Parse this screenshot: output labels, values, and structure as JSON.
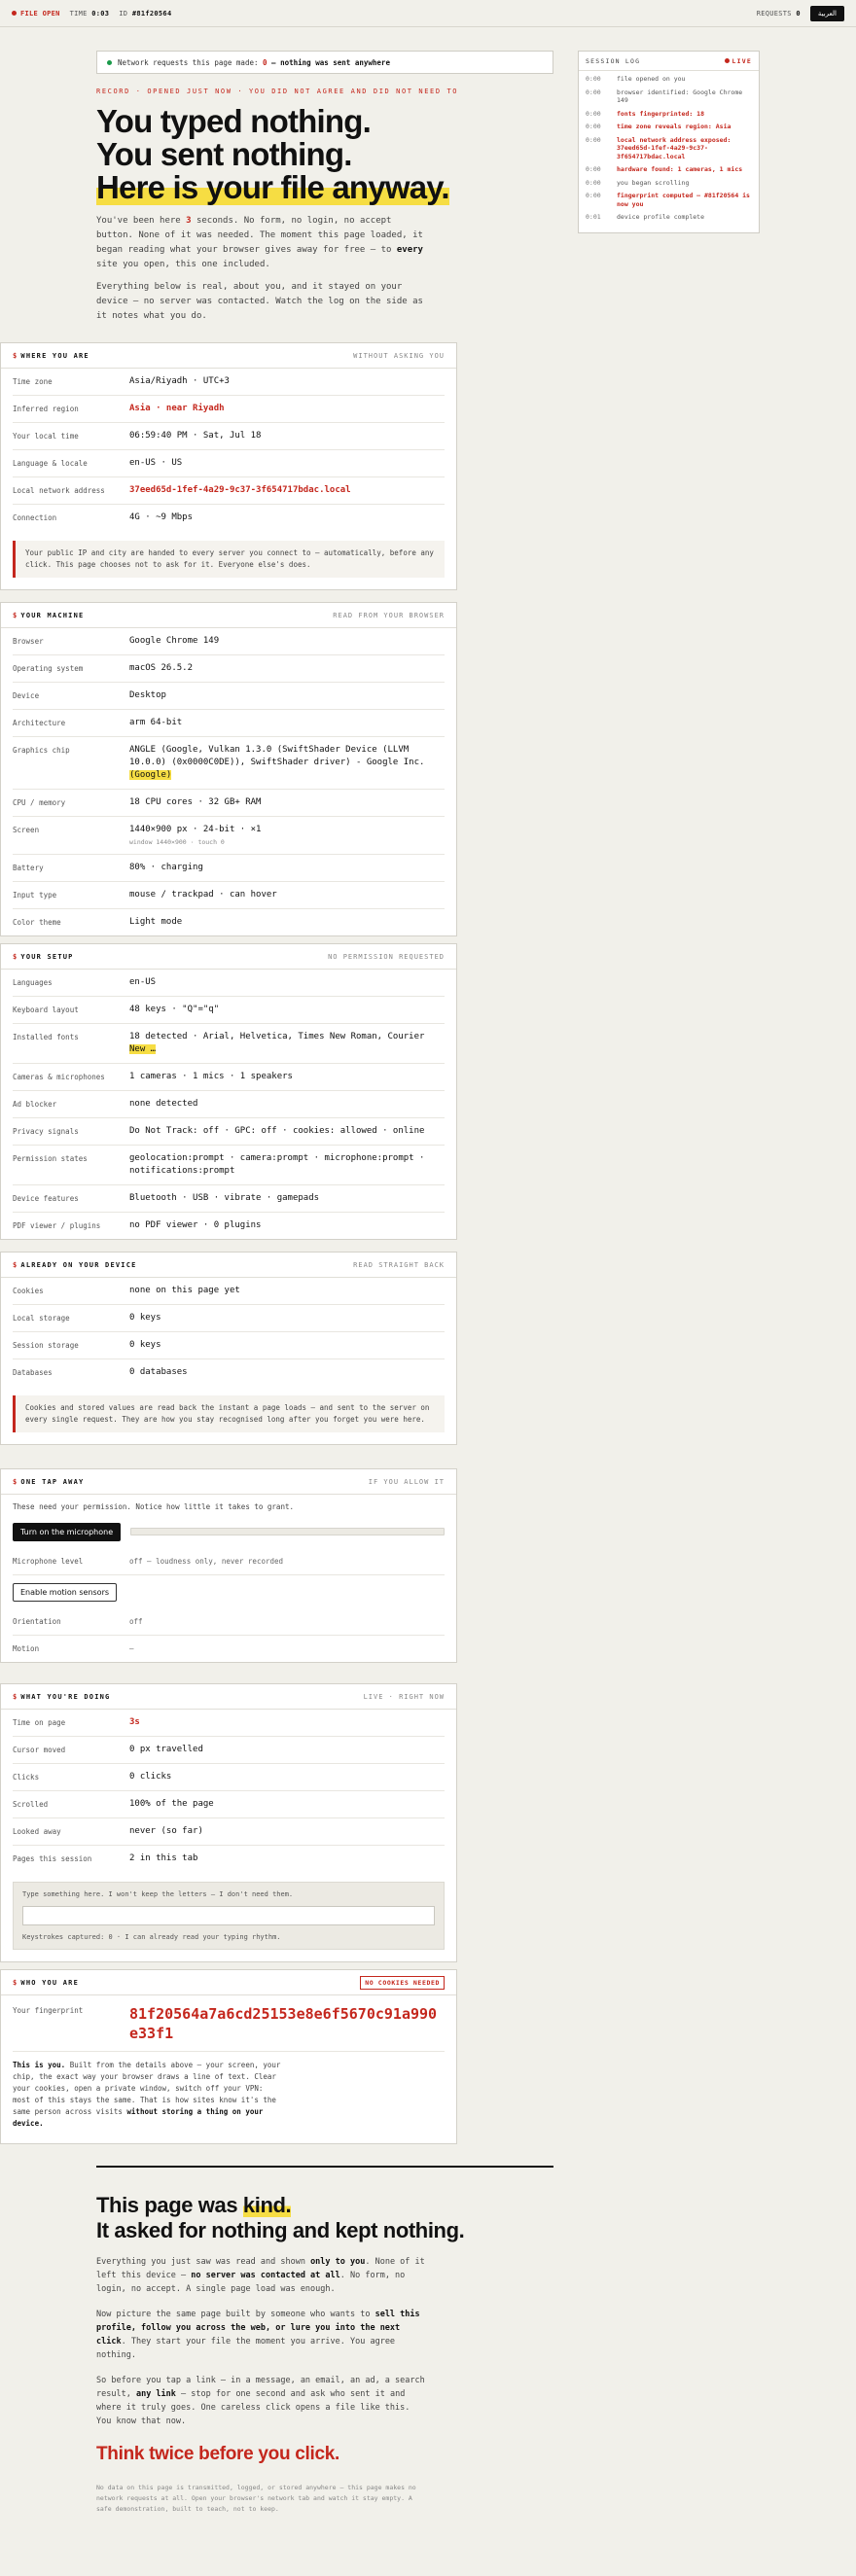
{
  "topbar": {
    "status": "FILE OPEN",
    "time_label": "TIME",
    "time_value": "0:03",
    "id_label": "ID",
    "id_value": "#81f20564",
    "requests_label": "REQUESTS",
    "requests_value": "0",
    "lang_button": "العربية"
  },
  "netbox": {
    "prefix": "Network requests this page made:",
    "count": "0",
    "suffix": "— nothing was sent anywhere"
  },
  "kicker": "RECORD · OPENED JUST NOW · YOU DID NOT AGREE AND DID NOT NEED TO",
  "hero": {
    "line1": "You typed nothing.",
    "line2": "You sent nothing.",
    "line3": "Here is your file anyway."
  },
  "lede": {
    "p1a": "You've been here ",
    "p1_secs": "3",
    "p1b": " seconds. No form, no login, no accept button. None of it was needed. The moment this page loaded, it began reading what your browser gives away for free — to ",
    "p1_every": "every",
    "p1c": " site you open, this one included.",
    "p2": "Everything below is real, about you, and it stayed on your device — no server was contacted. Watch the log on the side as it notes what you do."
  },
  "log": {
    "title": "SESSION LOG",
    "live": "LIVE",
    "items": [
      {
        "t": "0:00",
        "x": "file opened on you",
        "hot": false
      },
      {
        "t": "0:00",
        "x": "browser identified: Google Chrome 149",
        "hot": false
      },
      {
        "t": "0:00",
        "x": "fonts fingerprinted: 18",
        "hot": true
      },
      {
        "t": "0:00",
        "x": "time zone reveals region: Asia",
        "hot": true
      },
      {
        "t": "0:00",
        "x": "local network address exposed: 37eed65d-1fef-4a29-9c37-3f654717bdac.local",
        "hot": true
      },
      {
        "t": "0:00",
        "x": "hardware found: 1 cameras, 1 mics",
        "hot": true
      },
      {
        "t": "0:00",
        "x": "you began scrolling",
        "hot": false
      },
      {
        "t": "0:00",
        "x": "fingerprint computed — #81f20564 is now you",
        "hot": true
      },
      {
        "t": "0:01",
        "x": "device profile complete",
        "hot": false
      }
    ]
  },
  "where": {
    "title": "WHERE YOU ARE",
    "note": "WITHOUT ASKING YOU",
    "rows": [
      {
        "k": "Time zone",
        "v": "Asia/Riyadh · UTC+3"
      },
      {
        "k": "Inferred region",
        "v": "Asia · near Riyadh"
      },
      {
        "k": "Your local time",
        "v": "06:59:40 PM · Sat, Jul 18"
      },
      {
        "k": "Language & locale",
        "v": "en-US · US"
      },
      {
        "k": "Local network address",
        "v": "37eed65d-1fef-4a29-9c37-3f654717bdac.local"
      },
      {
        "k": "Connection",
        "v": "4G · ~9 Mbps"
      }
    ],
    "callout": "Your public IP and city are handed to every server you connect to — automatically, before any click. This page chooses not to ask for it. Everyone else's does."
  },
  "machine": {
    "title": "YOUR MACHINE",
    "note": "READ FROM YOUR BROWSER",
    "rows": [
      {
        "k": "Browser",
        "v": "Google Chrome 149"
      },
      {
        "k": "Operating system",
        "v": "macOS 26.5.2"
      },
      {
        "k": "Device",
        "v": "Desktop"
      },
      {
        "k": "Architecture",
        "v": "arm 64-bit"
      },
      {
        "k": "Graphics chip",
        "v": "ANGLE (Google, Vulkan 1.3.0 (SwiftShader Device (LLVM 10.0.0) (0x0000C0DE)), SwiftShader driver) - Google Inc. ",
        "v_hl": "(Google)"
      },
      {
        "k": "CPU / memory",
        "v": "18 CPU cores · 32 GB+ RAM"
      },
      {
        "k": "Screen",
        "v": "1440×900 px · 24-bit · ×1",
        "sub": "window 1440×900 · touch 0"
      },
      {
        "k": "Battery",
        "v": "80% · charging"
      },
      {
        "k": "Input type",
        "v": "mouse / trackpad · can hover"
      },
      {
        "k": "Color theme",
        "v": "Light mode"
      }
    ]
  },
  "setup": {
    "title": "YOUR SETUP",
    "note": "NO PERMISSION REQUESTED",
    "rows": [
      {
        "k": "Languages",
        "v": "en-US"
      },
      {
        "k": "Keyboard layout",
        "v": "48 keys · \"Q\"=\"q\""
      },
      {
        "k": "Installed fonts",
        "v": "18 detected · Arial, Helvetica, Times New Roman, Courier ",
        "v_hl": "New …"
      },
      {
        "k": "Cameras & microphones",
        "v": "1 cameras · 1 mics · 1 speakers"
      },
      {
        "k": "Ad blocker",
        "v": "none detected"
      },
      {
        "k": "Privacy signals",
        "v": "Do Not Track: off · GPC: off · cookies: allowed · online"
      },
      {
        "k": "Permission states",
        "v": "geolocation:prompt · camera:prompt · microphone:prompt · notifications:prompt"
      },
      {
        "k": "Device features",
        "v": "Bluetooth · USB · vibrate · gamepads"
      },
      {
        "k": "PDF viewer / plugins",
        "v": "no PDF viewer · 0 plugins"
      }
    ]
  },
  "device": {
    "title": "ALREADY ON YOUR DEVICE",
    "note": "READ STRAIGHT BACK",
    "rows": [
      {
        "k": "Cookies",
        "v": "none on this page yet"
      },
      {
        "k": "Local storage",
        "v": "0 keys"
      },
      {
        "k": "Session storage",
        "v": "0 keys"
      },
      {
        "k": "Databases",
        "v": "0 databases"
      }
    ],
    "callout": "Cookies and stored values are read back the instant a page loads — and sent to the server on every single request. They are how you stay recognised long after you forget you were here."
  },
  "tap": {
    "title": "ONE TAP AWAY",
    "note": "IF YOU ALLOW IT",
    "intro": "These need your permission. Notice how little it takes to grant.",
    "mic_button": "Turn on the microphone",
    "mic_level_k": "Microphone level",
    "mic_level_v": "off — loudness only, never recorded",
    "motion_button": "Enable motion sensors",
    "orientation_k": "Orientation",
    "orientation_v": "off",
    "motion_k": "Motion",
    "motion_v": "—",
    "mic_level_fraction": 0
  },
  "doing": {
    "title": "WHAT YOU'RE DOING",
    "note": "LIVE · RIGHT NOW",
    "rows": [
      {
        "k": "Time on page",
        "v": "3s",
        "red": true
      },
      {
        "k": "Cursor moved",
        "v": "0 px travelled"
      },
      {
        "k": "Clicks",
        "v": "0 clicks"
      },
      {
        "k": "Scrolled",
        "v": "100% of the page"
      },
      {
        "k": "Looked away",
        "v": "never (so far)"
      },
      {
        "k": "Pages this session",
        "v": "2 in this tab"
      }
    ],
    "type_label": "Type something here. I won't keep the letters — I don't need them.",
    "type_placeholder": "",
    "type_caption": "Keystrokes captured: 0 · I can already read your typing rhythm."
  },
  "who": {
    "title": "WHO YOU ARE",
    "badge": "NO COOKIES NEEDED",
    "fp_k": "Your fingerprint",
    "fp_v": "81f20564a7a6cd25153e8e6f5670c91a990e33f1",
    "p_lead": "This is you.",
    "p_body": " Built from the details above — your screen, your chip, the exact way your browser draws a line of text. Clear your cookies, open a private window, switch off your VPN: most of this stays the same. That is how sites know it's the same person across visits ",
    "p_tail": "without storing a thing on your device."
  },
  "footer": {
    "h_a": "This page was ",
    "h_kind": "kind.",
    "h_b": "It asked for nothing and kept nothing.",
    "p1a": "Everything you just saw was read and shown ",
    "p1_only": "only to you",
    "p1b": ". None of it left this device — ",
    "p1_none": "no server was contacted at all",
    "p1c": ". No form, no login, no accept. A single page load was enough.",
    "p2a": "Now picture the same page built by someone who wants to ",
    "p2_bold": "sell this profile, follow you across the web, or lure you into the next click",
    "p2b": ". They start your file the moment you arrive. You agree nothing.",
    "p3a": "So before you tap a link — in a message, an email, an ad, a search result, ",
    "p3_bold": "any link",
    "p3b": " — stop for one second and ask who sent it and where it truly goes. One careless click opens a file like this. You know that now.",
    "cta": "Think twice before you click.",
    "fine": "No data on this page is transmitted, logged, or stored anywhere — this page makes no network requests at all. Open your browser's network tab and watch it stay empty. A safe demonstration, built to teach, not to keep."
  }
}
